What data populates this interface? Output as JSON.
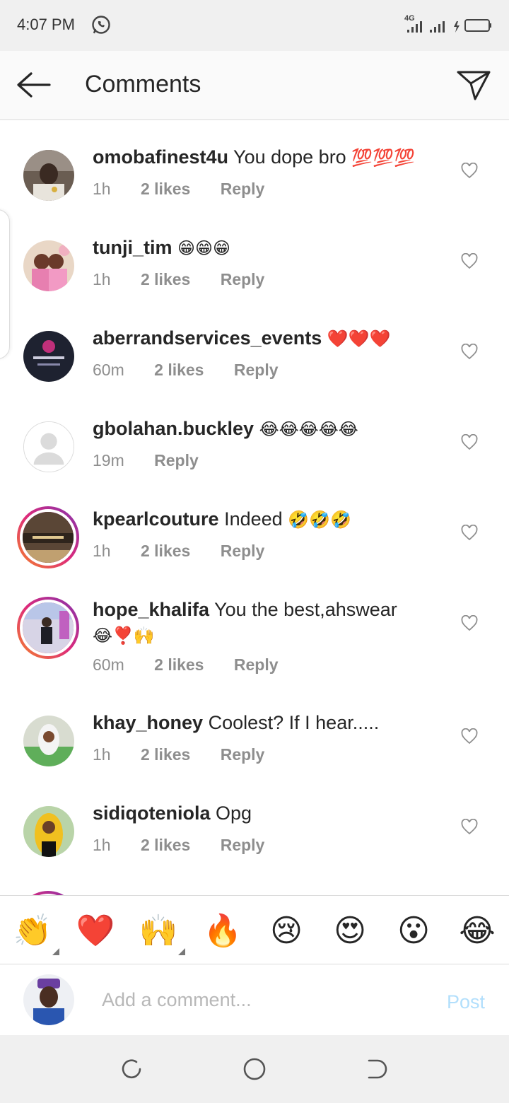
{
  "status": {
    "time": "4:07 PM",
    "network": "4G"
  },
  "header": {
    "title": "Comments"
  },
  "comments": [
    {
      "user": "omobafinest4u",
      "text": "You dope bro",
      "emoji": "💯💯💯",
      "time": "1h",
      "likes": "2 likes",
      "reply": "Reply"
    },
    {
      "user": "tunji_tim",
      "text": "",
      "emoji": "😁😁😁",
      "time": "1h",
      "likes": "2 likes",
      "reply": "Reply"
    },
    {
      "user": "aberrandservices_events",
      "text": "",
      "emoji": "❤️❤️❤️",
      "time": "60m",
      "likes": "2 likes",
      "reply": "Reply"
    },
    {
      "user": "gbolahan.buckley",
      "text": "",
      "emoji": "😂😂😂😂😂",
      "time": "19m",
      "likes": "",
      "reply": "Reply"
    },
    {
      "user": "kpearlcouture",
      "text": "Indeed",
      "emoji": "🤣🤣🤣",
      "time": "1h",
      "likes": "2 likes",
      "reply": "Reply"
    },
    {
      "user": "hope_khalifa",
      "text": "You the best,ahswear",
      "emoji": "😂❣️🙌",
      "time": "60m",
      "likes": "2 likes",
      "reply": "Reply"
    },
    {
      "user": "khay_honey",
      "text": "Coolest? If I hear.....",
      "emoji": "",
      "time": "1h",
      "likes": "2 likes",
      "reply": "Reply"
    },
    {
      "user": "sidiqoteniola",
      "text": "Opg",
      "emoji": "",
      "time": "1h",
      "likes": "2 likes",
      "reply": "Reply"
    }
  ],
  "reactions": [
    "👏",
    "❤️",
    "🙌",
    "🔥",
    "😢",
    "😍",
    "😮",
    "😂"
  ],
  "composer": {
    "placeholder": "Add a comment...",
    "post_label": "Post"
  },
  "icons": {
    "back": "arrow-left-icon",
    "send": "paper-plane-icon",
    "heart": "heart-outline-icon",
    "whatsapp": "whatsapp-icon",
    "signal": "signal-icon",
    "battery": "battery-icon",
    "nav_recent": "recent-apps-icon",
    "nav_home": "home-icon",
    "nav_back": "back-nav-icon"
  },
  "colors": {
    "accent": "#b2dffc",
    "meta_text": "#8e8e8e",
    "story_ring_start": "#f58529",
    "story_ring_end": "#8134af"
  }
}
